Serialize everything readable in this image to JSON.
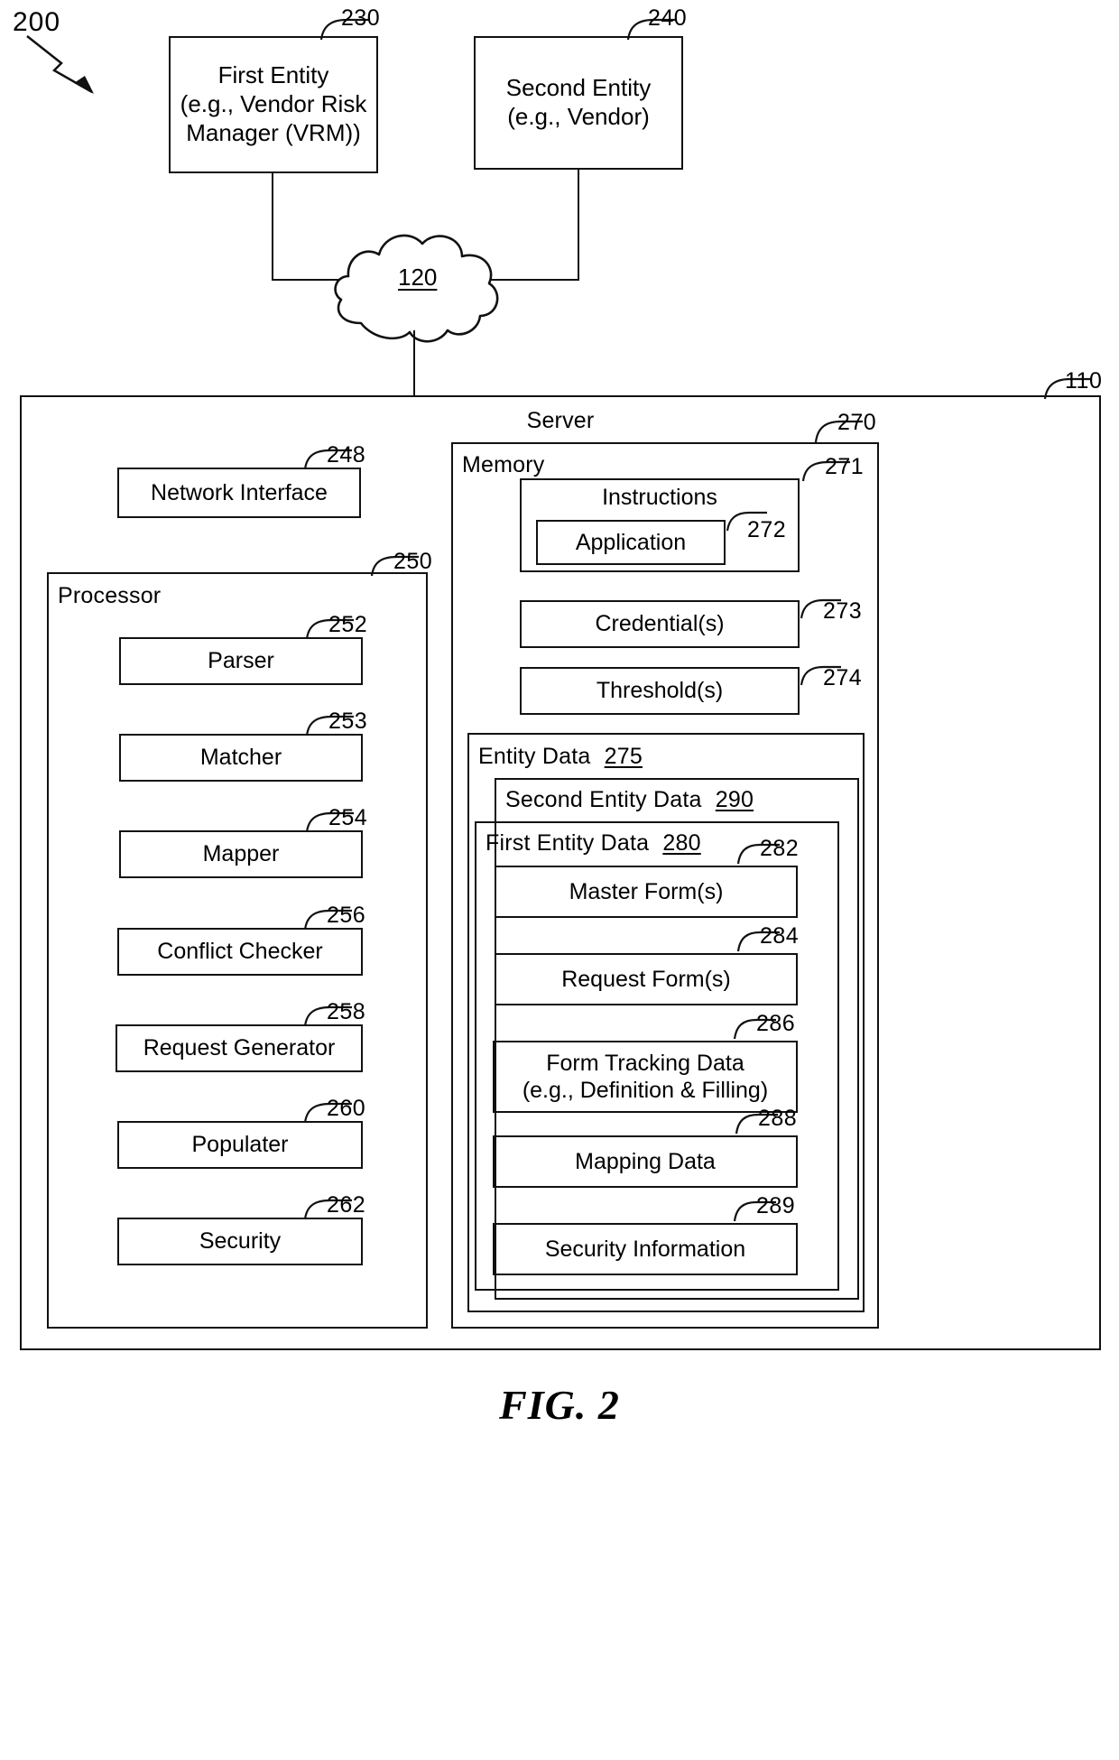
{
  "figure": {
    "id": "200",
    "caption": "FIG. 2"
  },
  "top_entities": [
    {
      "label": "First Entity\n(e.g., Vendor Risk\nManager (VRM))",
      "ref": "230"
    },
    {
      "label": "Second Entity\n(e.g., Vendor)",
      "ref": "240"
    }
  ],
  "network": {
    "label": "120"
  },
  "server": {
    "title": "Server",
    "ref": "110",
    "network_interface": {
      "label": "Network Interface",
      "ref": "248"
    },
    "processor": {
      "title": "Processor",
      "ref": "250",
      "components": [
        {
          "label": "Parser",
          "ref": "252"
        },
        {
          "label": "Matcher",
          "ref": "253"
        },
        {
          "label": "Mapper",
          "ref": "254"
        },
        {
          "label": "Conflict Checker",
          "ref": "256"
        },
        {
          "label": "Request Generator",
          "ref": "258"
        },
        {
          "label": "Populater",
          "ref": "260"
        },
        {
          "label": "Security",
          "ref": "262"
        }
      ]
    },
    "memory": {
      "title": "Memory",
      "ref": "270",
      "instructions": {
        "label": "Instructions",
        "ref": "271",
        "application": {
          "label": "Application",
          "ref": "272"
        }
      },
      "items": [
        {
          "label": "Credential(s)",
          "ref": "273"
        },
        {
          "label": "Threshold(s)",
          "ref": "274"
        }
      ],
      "entity_data": {
        "title": "Entity Data",
        "ref": "275",
        "second_entity_data": {
          "title": "Second Entity Data",
          "ref": "290"
        },
        "first_entity_data": {
          "title": "First Entity Data",
          "ref": "280",
          "items": [
            {
              "label": "Master Form(s)",
              "ref": "282"
            },
            {
              "label": "Request Form(s)",
              "ref": "284"
            },
            {
              "label": "Form Tracking Data\n(e.g., Definition & Filling)",
              "ref": "286"
            },
            {
              "label": "Mapping Data",
              "ref": "288"
            },
            {
              "label": "Security Information",
              "ref": "289"
            }
          ]
        }
      }
    }
  }
}
